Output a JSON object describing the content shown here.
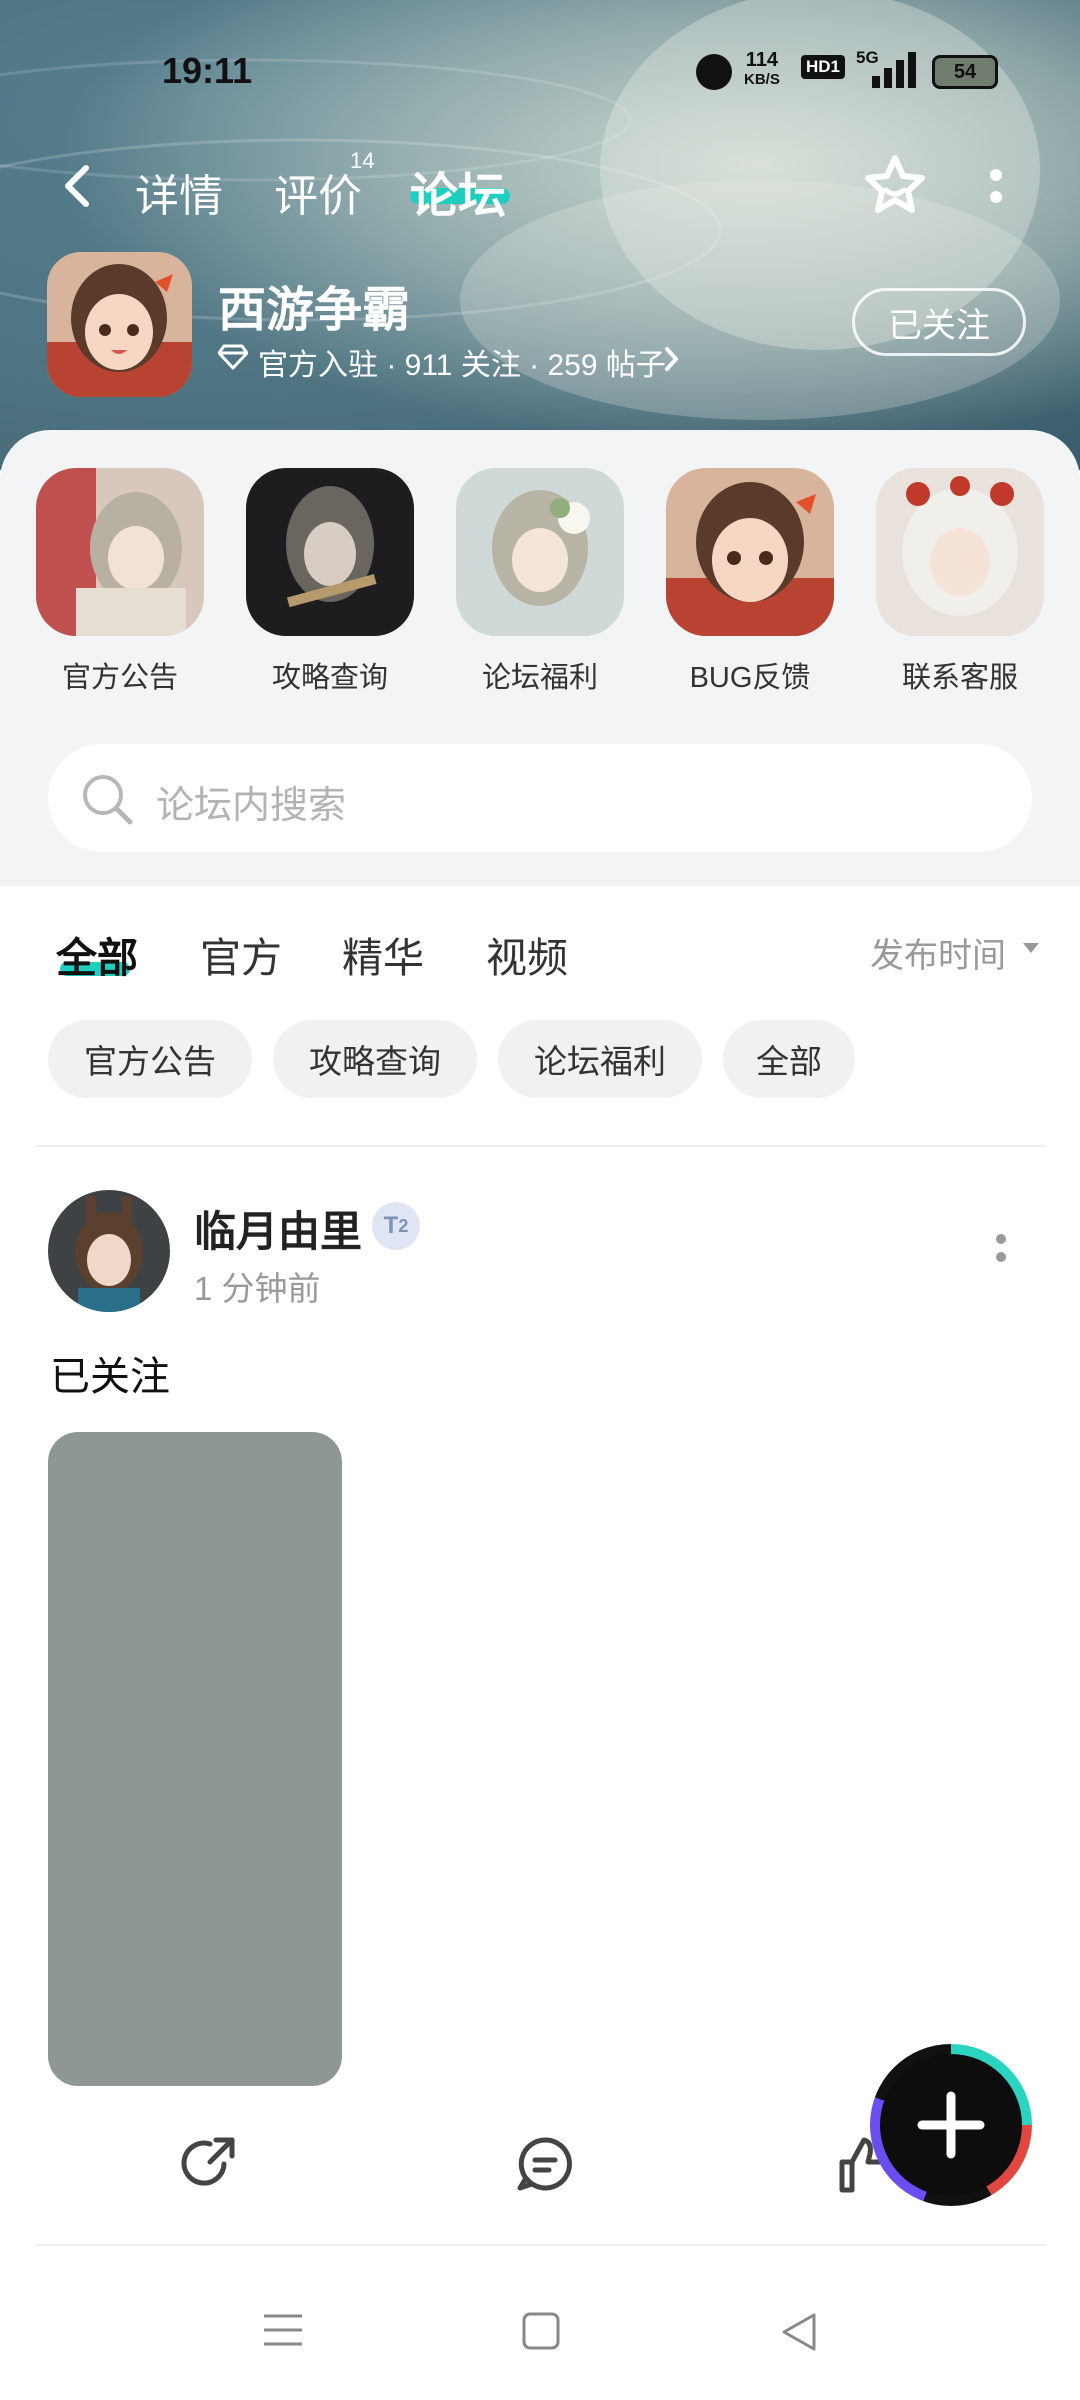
{
  "status_bar": {
    "time": "19:11",
    "net_speed": "114",
    "net_unit": "KB/S",
    "hd": "HD1",
    "signal": "5G",
    "battery": "54"
  },
  "top_nav": {
    "tabs": [
      {
        "label": "详情",
        "badge": ""
      },
      {
        "label": "评价",
        "badge": "14"
      },
      {
        "label": "论坛",
        "badge": ""
      }
    ],
    "active_tab": "论坛"
  },
  "game": {
    "name": "西游争霸",
    "meta": "官方入驻 · 911 关注 · 259 帖子",
    "follow_label": "已关注"
  },
  "shortcuts": [
    {
      "label": "官方公告"
    },
    {
      "label": "攻略查询"
    },
    {
      "label": "论坛福利"
    },
    {
      "label": "BUG反馈"
    },
    {
      "label": "联系客服"
    }
  ],
  "search": {
    "placeholder": "论坛内搜索"
  },
  "filter_tabs": [
    {
      "label": "全部",
      "active": true
    },
    {
      "label": "官方",
      "active": false
    },
    {
      "label": "精华",
      "active": false
    },
    {
      "label": "视频",
      "active": false
    }
  ],
  "sort": {
    "label": "发布时间"
  },
  "chips": [
    "官方公告",
    "攻略查询",
    "论坛福利",
    "全部"
  ],
  "post": {
    "author": "临月由里",
    "level": "2",
    "time": "1 分钟前",
    "content": "已关注"
  },
  "colors": {
    "accent": "#1ecfbf",
    "placeholder_image": "#8e9696"
  }
}
